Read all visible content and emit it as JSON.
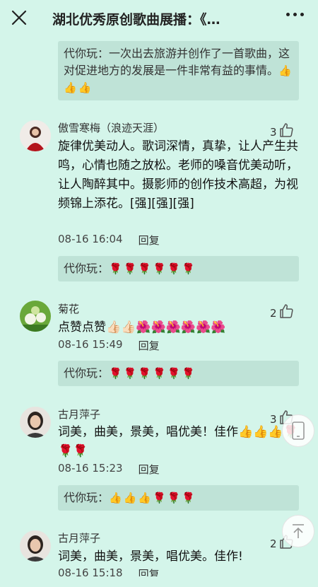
{
  "header": {
    "title": "湖北优秀原创歌曲展播：《…",
    "close_icon": "close-icon",
    "more_icon": "more-icon"
  },
  "top_reply": {
    "who": "代你玩：",
    "text": "一次出去旅游并创作了一首歌曲，这对促进地方的发展是一件非常有益的事情。",
    "emoji": "👍👍👍"
  },
  "comments": [
    {
      "name": "傲雪寒梅（浪迹天涯）",
      "likes": "3",
      "text": "旋律优美动人。歌词深情，真挚，让人产生共鸣，心情也随之放松。老师的嗓音优美动听，让人陶醉其中。摄影师的创作技术高超，为视频锦上添花。[强][强][强]",
      "time": "08-16 16:04",
      "reply_label": "回复",
      "reply": {
        "who": "代你玩：",
        "emoji": "🌹🌹🌹🌹🌹🌹"
      }
    },
    {
      "name": "菊花",
      "likes": "2",
      "text": "点赞点赞👍🏻👍🏻🌺🌺🌺🌺🌺🌺",
      "time": "08-16 15:49",
      "reply_label": "回复",
      "reply": {
        "who": "代你玩：",
        "emoji": "🌹🌹🌹🌹🌹🌹"
      }
    },
    {
      "name": "古月萍子",
      "likes": "3",
      "text": "词美，曲美，景美，唱优美！佳作👍👍👍🌹🌹🌹",
      "time": "08-16 15:23",
      "reply_label": "回复",
      "reply": {
        "who": "代你玩：",
        "emoji": "👍👍👍🌹🌹🌹"
      }
    },
    {
      "name": "古月萍子",
      "likes": "2",
      "text": "词美，曲美，景美，唱优美。佳作!",
      "time": "08-16 15:18",
      "reply_label": "回复"
    }
  ],
  "colors": {
    "background": "#d4f5ea",
    "reply_bg": "#bfe3d7"
  }
}
